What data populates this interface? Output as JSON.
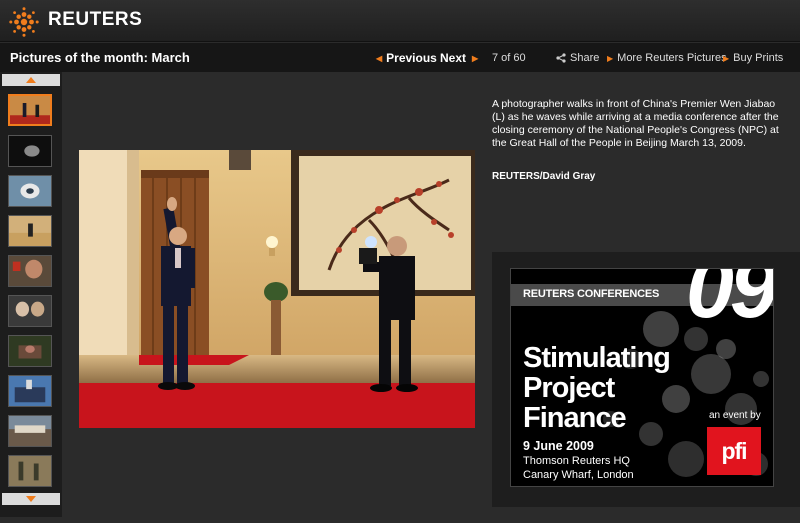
{
  "header": {
    "brand": "REUTERS"
  },
  "titlebar": {
    "title": "Pictures of the month: March",
    "previous": "Previous",
    "next": "Next",
    "counter": "7 of 60",
    "share": "Share",
    "more": "More Reuters Pictures",
    "buy": "Buy Prints"
  },
  "caption": {
    "text": "A photographer walks in front of China's Premier Wen Jiabao (L) as he waves while arriving at a media conference after the closing ceremony of the National People's Congress (NPC) at the Great Hall of the People in Beijing March 13, 2009.",
    "credit": "REUTERS/David Gray"
  },
  "ad": {
    "conference": "REUTERS CONFERENCES",
    "year": "09",
    "line1": "Stimulating",
    "line2": "Project",
    "line3": "Finance",
    "date": "9 June 2009",
    "venue1": "Thomson Reuters HQ",
    "venue2": "Canary Wharf, London",
    "event_by": "an event by",
    "pfi": "pfi"
  },
  "colors": {
    "accent": "#f07d1d",
    "pfi_red": "#e1141e"
  }
}
